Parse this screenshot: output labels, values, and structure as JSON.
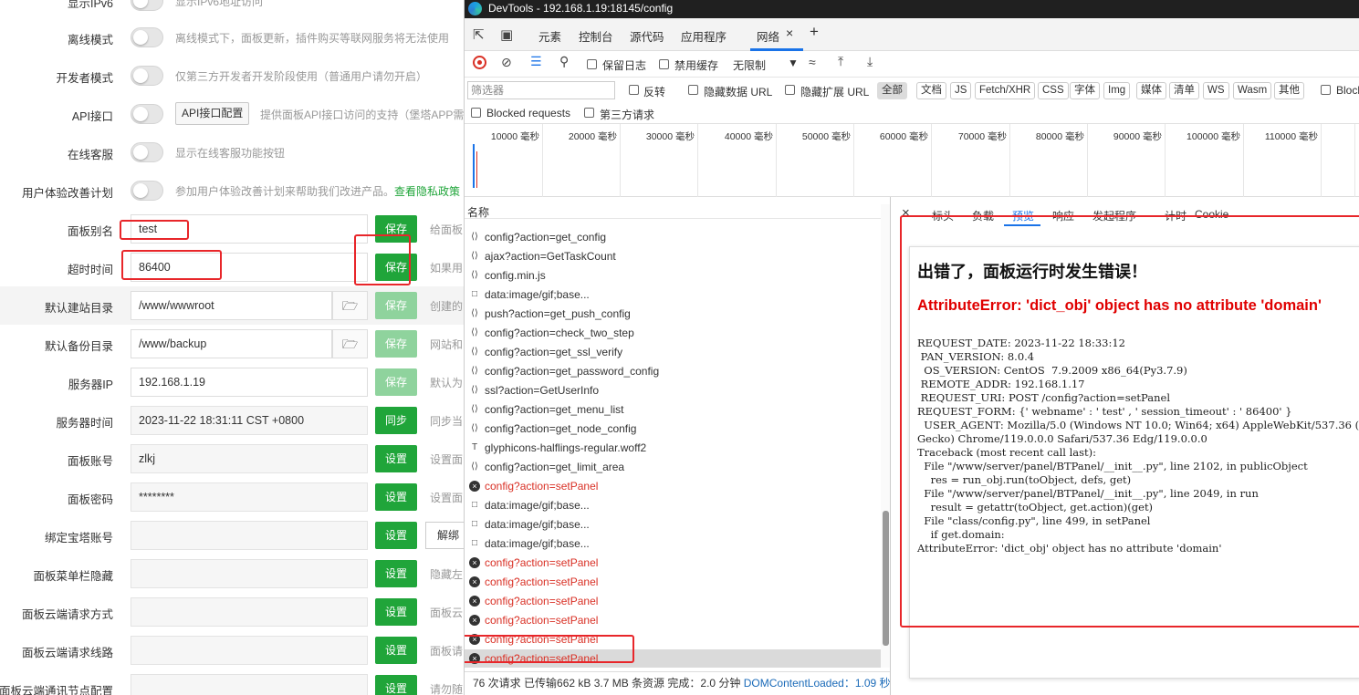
{
  "panel": {
    "rows": [
      {
        "label": "显示IPv6",
        "desc": "显示IPv6地址访问"
      },
      {
        "label": "离线模式",
        "desc": "离线模式下，面板更新，插件购买等联网服务将无法使用"
      },
      {
        "label": "开发者模式",
        "desc": "仅第三方开发者开发阶段使用（普通用户请勿开启）"
      },
      {
        "label": "API接口",
        "btn": "API接口配置",
        "desc": "提供面板API接口访问的支持（堡塔APP需"
      },
      {
        "label": "在线客服",
        "desc": "显示在线客服功能按钮"
      },
      {
        "label": "用户体验改善计划",
        "desc": "参加用户体验改善计划来帮助我们改进产品。",
        "link": "查看隐私政策"
      },
      {
        "label": "面板别名",
        "value": "test",
        "btn": "保存",
        "desc": "给面板"
      },
      {
        "label": "超时时间",
        "value": "86400",
        "btn": "保存",
        "desc": "如果用"
      },
      {
        "label": "默认建站目录",
        "value": "/www/wwwroot",
        "btn": "保存",
        "desc": "创建的"
      },
      {
        "label": "默认备份目录",
        "value": "/www/backup",
        "btn": "保存",
        "desc": "网站和"
      },
      {
        "label": "服务器IP",
        "value": "192.168.1.19",
        "btn": "保存",
        "desc": "默认为"
      },
      {
        "label": "服务器时间",
        "value": "2023-11-22 18:31:11 CST +0800",
        "btn": "同步",
        "desc": "同步当"
      },
      {
        "label": "面板账号",
        "value": "zlkj",
        "btn": "设置",
        "desc": "设置面"
      },
      {
        "label": "面板密码",
        "value": "********",
        "btn": "设置",
        "desc": "设置面"
      },
      {
        "label": "绑定宝塔账号",
        "value": "",
        "btn": "设置",
        "btn2": "解绑"
      },
      {
        "label": "面板菜单栏隐藏",
        "value": "",
        "btn": "设置",
        "desc": "隐藏左"
      },
      {
        "label": "面板云端请求方式",
        "value": "",
        "btn": "设置",
        "desc": "面板云"
      },
      {
        "label": "面板云端请求线路",
        "value": "",
        "btn": "设置",
        "desc": "面板请"
      },
      {
        "label": "面板云端通讯节点配置",
        "value": "",
        "btn": "设置",
        "desc": "请勿随"
      }
    ],
    "folder_icon": "folder-open-icon"
  },
  "devtools": {
    "title": "DevTools - 192.168.1.19:18145/config",
    "tabs": [
      "元素",
      "控制台",
      "源代码",
      "应用程序",
      "网络"
    ],
    "plus": "+",
    "toolbar": {
      "preserve_log": "保留日志",
      "disable_cache": "禁用缓存",
      "throttle": "无限制"
    },
    "filter": {
      "placeholder": "筛选器",
      "invert": "反转",
      "hide_data_urls": "隐藏数据 URL",
      "hide_ext_urls": "隐藏扩展 URL",
      "types": [
        "全部",
        "文档",
        "JS",
        "Fetch/XHR",
        "CSS",
        "字体",
        "Img",
        "媒体",
        "清单",
        "WS",
        "Wasm",
        "其他"
      ],
      "blocked_cookies": "Block",
      "blocked_requests": "Blocked requests",
      "third_party": "第三方请求"
    },
    "timeline_ticks": [
      "10000 毫秒",
      "20000 毫秒",
      "30000 毫秒",
      "40000 毫秒",
      "50000 毫秒",
      "60000 毫秒",
      "70000 毫秒",
      "80000 毫秒",
      "90000 毫秒",
      "100000 毫秒",
      "110000 毫秒",
      "120"
    ],
    "list_header": "名称",
    "requests": [
      {
        "name": "config?action=get_config",
        "type": "xhr",
        "err": false
      },
      {
        "name": "ajax?action=GetTaskCount",
        "type": "xhr",
        "err": false
      },
      {
        "name": "config.min.js",
        "type": "js",
        "err": false
      },
      {
        "name": "data:image/gif;base...",
        "type": "doc",
        "err": false
      },
      {
        "name": "push?action=get_push_config",
        "type": "xhr",
        "err": false
      },
      {
        "name": "config?action=check_two_step",
        "type": "xhr",
        "err": false
      },
      {
        "name": "config?action=get_ssl_verify",
        "type": "xhr",
        "err": false
      },
      {
        "name": "config?action=get_password_config",
        "type": "xhr",
        "err": false
      },
      {
        "name": "ssl?action=GetUserInfo",
        "type": "xhr",
        "err": false
      },
      {
        "name": "config?action=get_menu_list",
        "type": "xhr",
        "err": false
      },
      {
        "name": "config?action=get_node_config",
        "type": "xhr",
        "err": false
      },
      {
        "name": "glyphicons-halflings-regular.woff2",
        "type": "font",
        "err": false
      },
      {
        "name": "config?action=get_limit_area",
        "type": "xhr",
        "err": false
      },
      {
        "name": "config?action=setPanel",
        "type": "err",
        "err": true
      },
      {
        "name": "data:image/gif;base...",
        "type": "doc",
        "err": false
      },
      {
        "name": "data:image/gif;base...",
        "type": "doc",
        "err": false
      },
      {
        "name": "data:image/gif;base...",
        "type": "doc",
        "err": false
      },
      {
        "name": "config?action=setPanel",
        "type": "err",
        "err": true
      },
      {
        "name": "config?action=setPanel",
        "type": "err",
        "err": true
      },
      {
        "name": "config?action=setPanel",
        "type": "err",
        "err": true
      },
      {
        "name": "config?action=setPanel",
        "type": "err",
        "err": true
      },
      {
        "name": "config?action=setPanel",
        "type": "err",
        "err": true
      },
      {
        "name": "config?action=setPanel",
        "type": "err",
        "err": true
      }
    ],
    "status": {
      "text": "76 次请求  已传输662 kB  3.7 MB 条资源  完成：2.0 分钟  ",
      "dcl": "DOMContentLoaded：1.09 秒"
    },
    "pane_tabs": [
      "标头",
      "负载",
      "预览",
      "响应",
      "发起程序",
      "计时",
      "Cookie"
    ],
    "preview": {
      "title": "出错了，面板运行时发生错误！",
      "error": "AttributeError: 'dict_obj' object has no attribute 'domain'",
      "trace": "REQUEST_DATE: 2023-11-22 18:33:12\n PAN_VERSION: 8.0.4\n  OS_VERSION: CentOS  7.9.2009 x86_64(Py3.7.9)\n REMOTE_ADDR: 192.168.1.17\n REQUEST_URI: POST /config?action=setPanel\nREQUEST_FORM: {' webname' : ' test' , ' session_timeout' : ' 86400' }\n  USER_AGENT: Mozilla/5.0 (Windows NT 10.0; Win64; x64) AppleWebKit/537.36 (KHTML, like\nGecko) Chrome/119.0.0.0 Safari/537.36 Edg/119.0.0.0\nTraceback (most recent call last):\n  File \"/www/server/panel/BTPanel/__init__.py\", line 2102, in publicObject\n    res = run_obj.run(toObject, defs, get)\n  File \"/www/server/panel/BTPanel/__init__.py\", line 2049, in run\n    result = getattr(toObject, get.action)(get)\n  File \"class/config.py\", line 499, in setPanel\n    if get.domain:\nAttributeError: 'dict_obj' object has no attribute 'domain'"
    }
  }
}
